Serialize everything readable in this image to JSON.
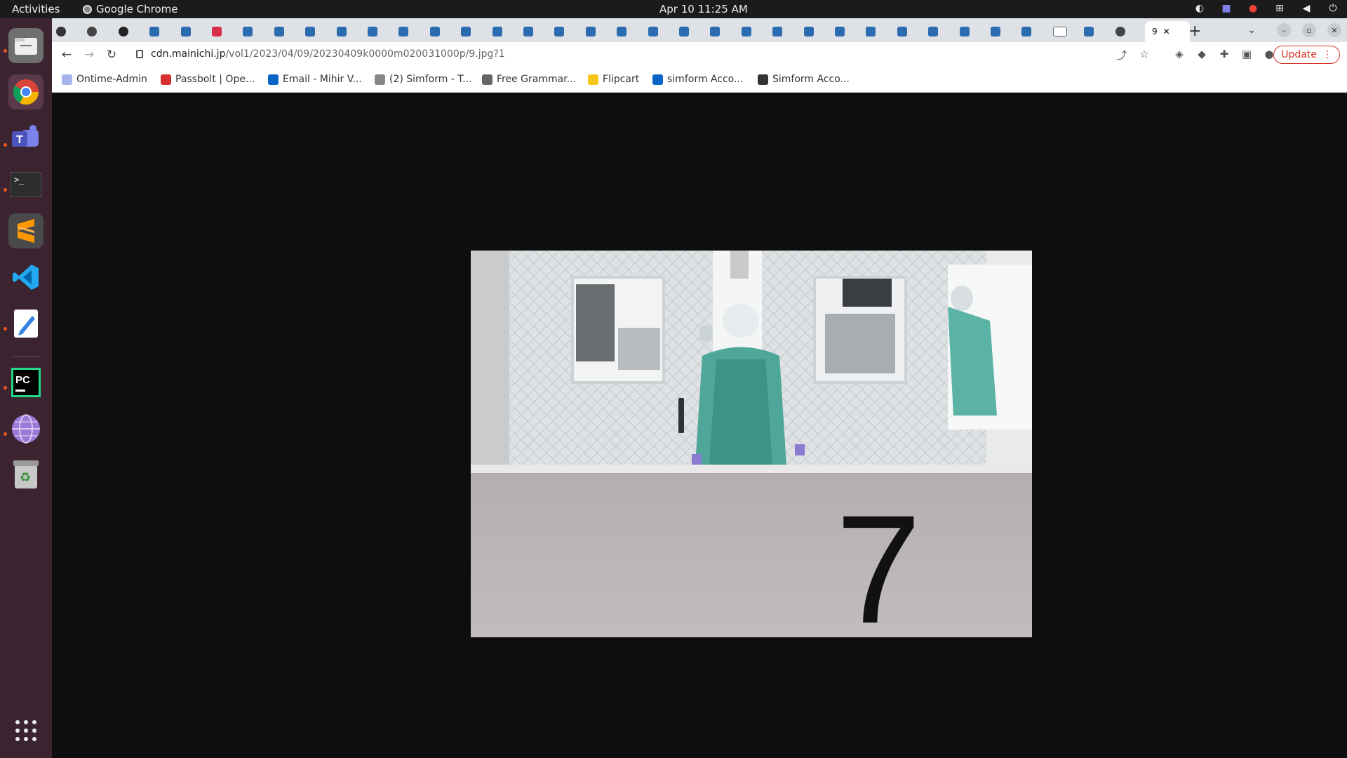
{
  "topbar": {
    "activities": "Activities",
    "app_name": "Google Chrome",
    "clock": "Apr 10  11:25 AM"
  },
  "dock": {
    "items": [
      "files-icon",
      "chrome-icon",
      "teams-icon",
      "terminal-icon",
      "sublime-text-icon",
      "vscode-icon",
      "text-editor-icon",
      "pycharm-icon",
      "network-globe-icon",
      "trash-icon"
    ],
    "show_apps": "show-applications-icon"
  },
  "browser": {
    "active_tab_label": "9",
    "url_host": "cdn.mainichi.jp",
    "url_path": "/vol1/2023/04/09/20230409k0000m020031000p/9.jpg?1",
    "update_label": "Update",
    "bookmarks": [
      {
        "label": "Ontime-Admin",
        "color": "#a8b4f0"
      },
      {
        "label": "Passbolt | Ope...",
        "color": "#d62f2f"
      },
      {
        "label": "Email - Mihir V...",
        "color": "#0a64c8"
      },
      {
        "label": "(2) Simform - T...",
        "color": "#888888"
      },
      {
        "label": "Free Grammar...",
        "color": "#666666"
      },
      {
        "label": "Flipcart",
        "color": "#f5c518"
      },
      {
        "label": "simform Acco...",
        "color": "#0a64c8"
      },
      {
        "label": "Simform Acco...",
        "color": "#333333"
      }
    ]
  },
  "image": {
    "overlay_text": "7"
  }
}
